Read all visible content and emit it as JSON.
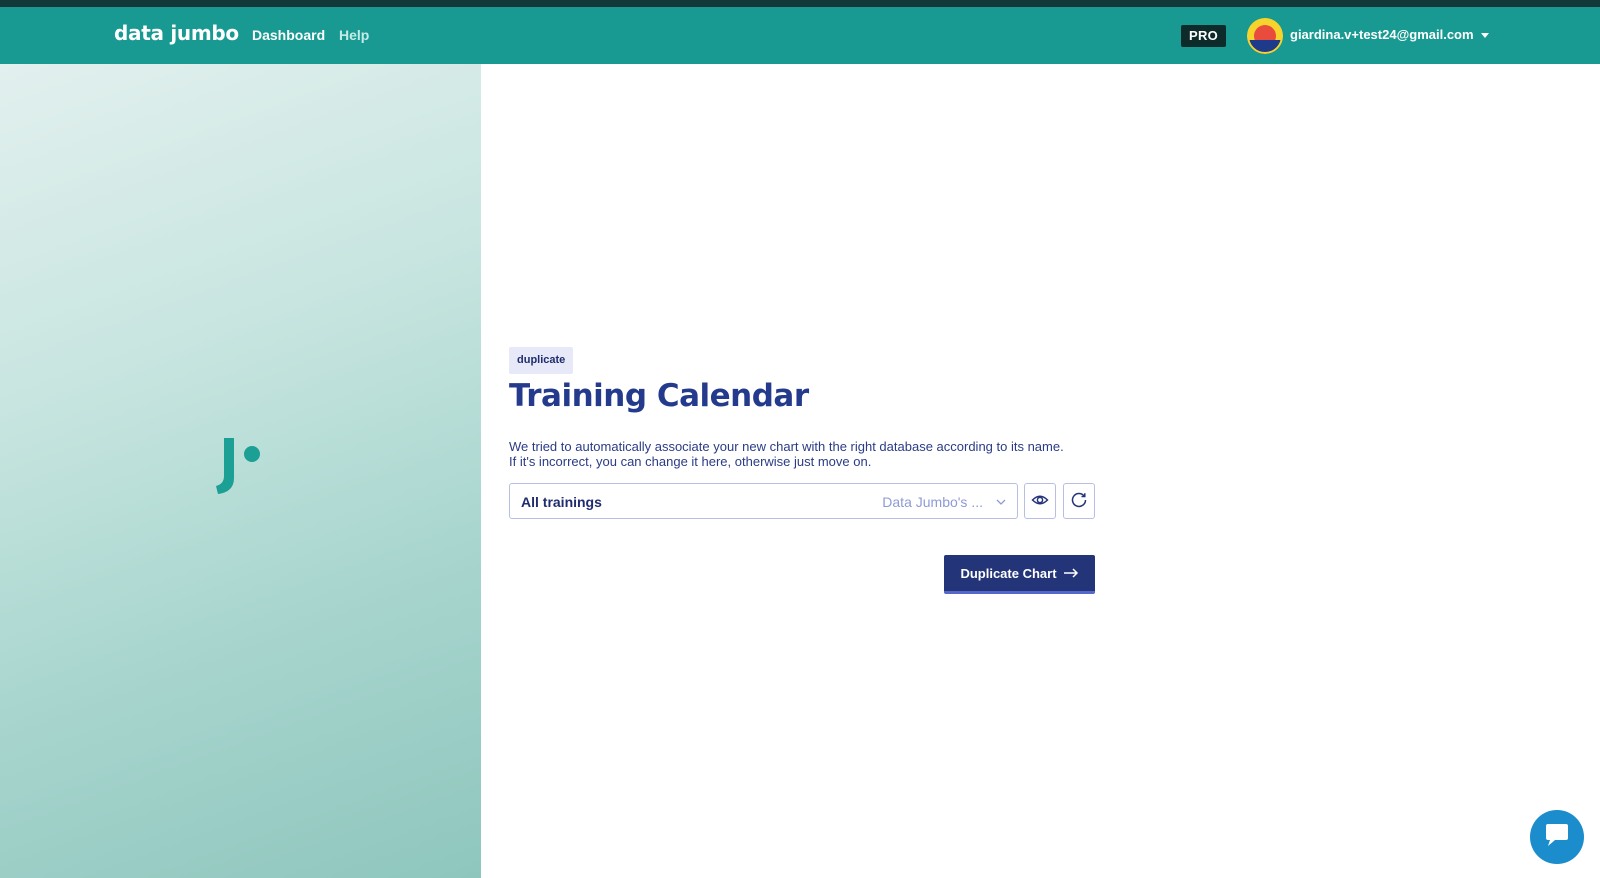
{
  "header": {
    "logo": "data jumbo",
    "nav": [
      {
        "label": "Dashboard"
      },
      {
        "label": "Help"
      }
    ],
    "pro_badge": "PRO",
    "user_email": "giardina.v+test24@gmail.com"
  },
  "main": {
    "tag": "duplicate",
    "title": "Training Calendar",
    "description_lines": [
      "We tried to automatically associate your new chart with the right database according to its name.",
      "If it's incorrect, you can change it here, otherwise just move on."
    ],
    "database_select": {
      "value": "All trainings",
      "meta": "Data Jumbo's ..."
    },
    "duplicate_button_label": "Duplicate Chart"
  },
  "icons": [
    "caret-down-icon",
    "j-logo",
    "chevron-down-icon",
    "eye-icon",
    "refresh-icon",
    "arrow-right-icon",
    "chat-icon"
  ],
  "colors": {
    "navbar": "#189a92",
    "primary": "#243479",
    "title": "#243a8c",
    "chat": "#1b8ccc"
  }
}
